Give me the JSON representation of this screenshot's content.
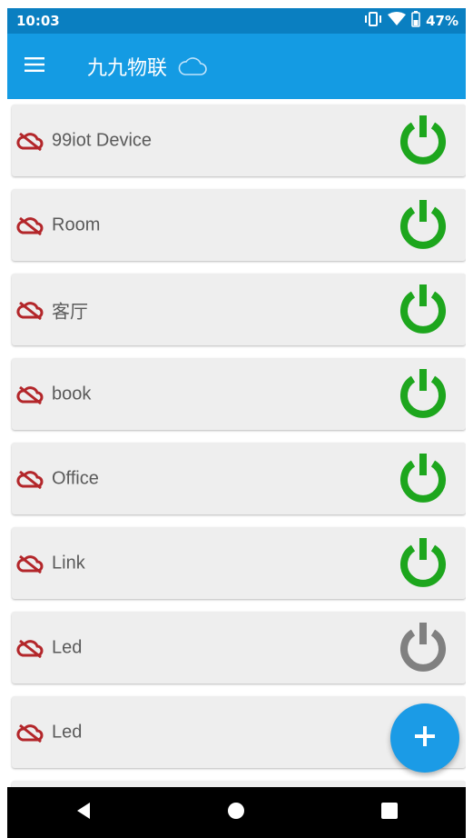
{
  "status_bar": {
    "time": "10:03",
    "battery_text": "47%",
    "icons": [
      "vibrate-icon",
      "wifi-icon",
      "battery-icon"
    ]
  },
  "app_bar": {
    "menu_icon": "menu-icon",
    "title": "九九物联",
    "cloud_icon": "cloud-icon"
  },
  "devices": [
    {
      "name": "99iot Device",
      "power_state": "on"
    },
    {
      "name": "Room",
      "power_state": "on"
    },
    {
      "name": "客厅",
      "power_state": "on"
    },
    {
      "name": "book",
      "power_state": "on"
    },
    {
      "name": "Office",
      "power_state": "on"
    },
    {
      "name": "Link",
      "power_state": "on"
    },
    {
      "name": "Led",
      "power_state": "off"
    },
    {
      "name": "Led",
      "power_state": "none"
    }
  ],
  "fab": {
    "icon": "plus-icon",
    "label": "+"
  },
  "nav_bar": {
    "icons": [
      "back-icon",
      "home-icon",
      "recents-icon"
    ]
  },
  "colors": {
    "status_bar": "#0a7fc1",
    "app_bar": "#149be3",
    "power_on": "#1da61d",
    "power_off": "#808080",
    "cloud_offline": "#b3262a",
    "fab": "#1b9be6",
    "row_bg": "#eeeeee",
    "label_text": "#5a5a5a"
  }
}
